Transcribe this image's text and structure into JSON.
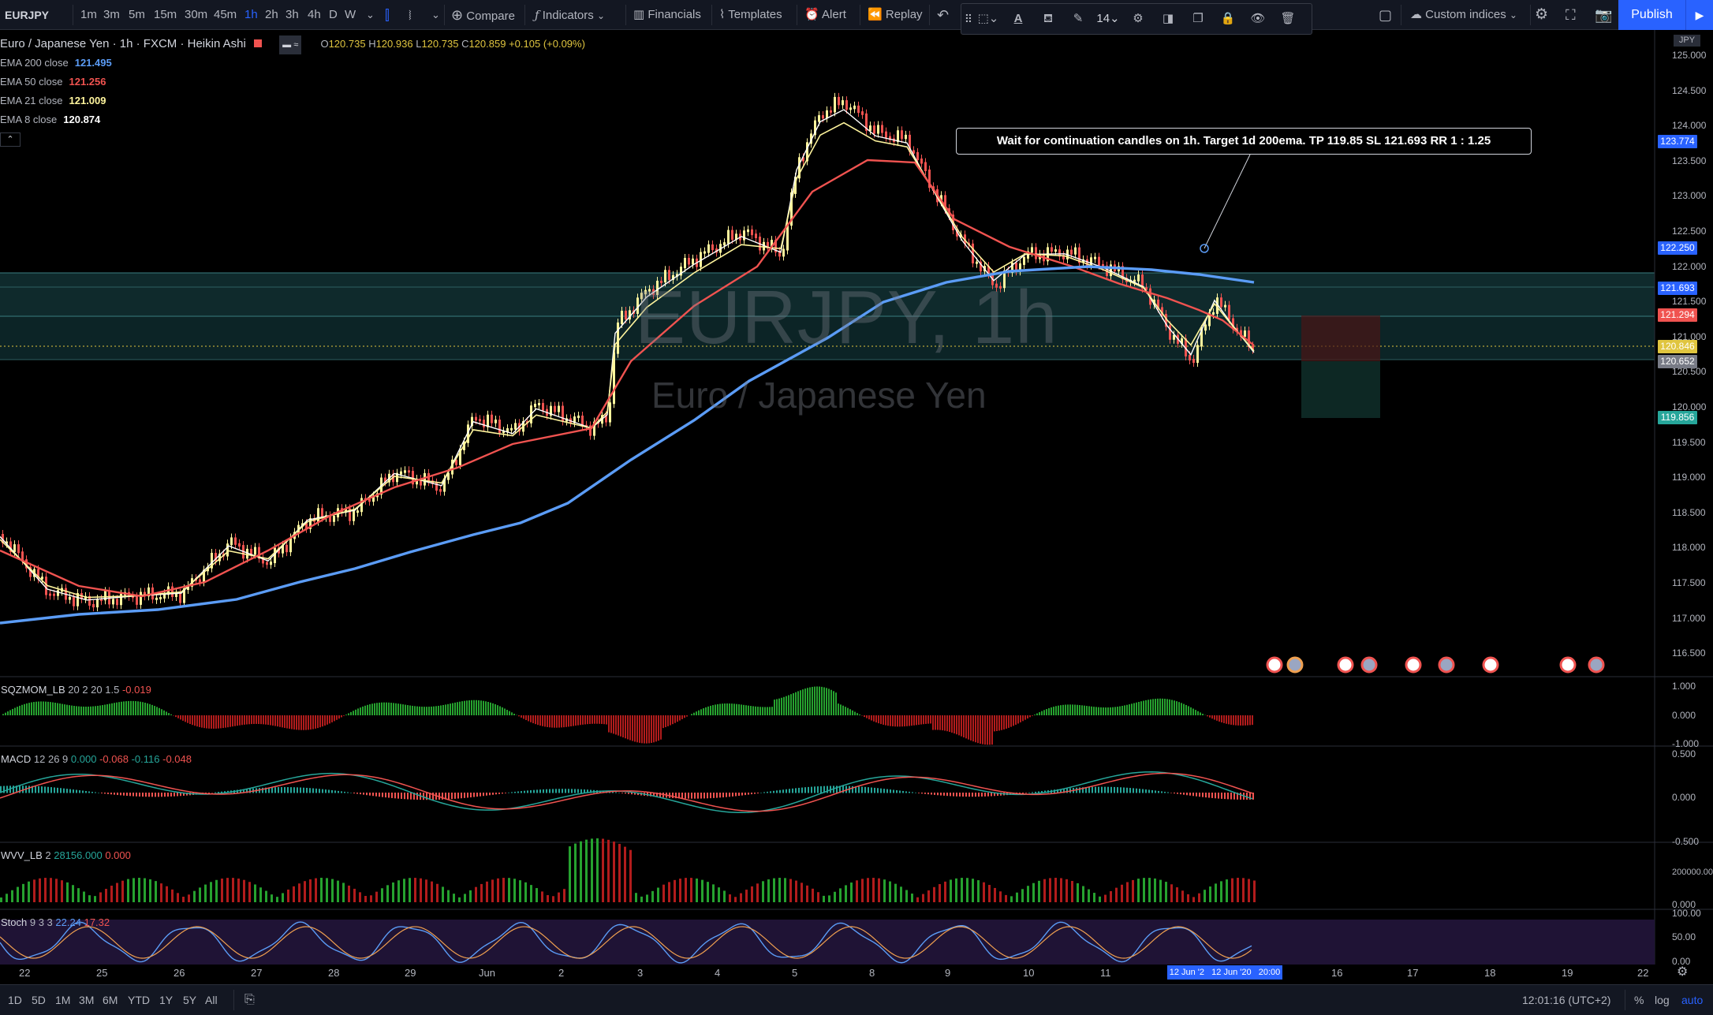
{
  "symbol": "EURJPY",
  "toolbar": {
    "intervals": [
      "1m",
      "3m",
      "5m",
      "15m",
      "30m",
      "45m",
      "1h",
      "2h",
      "3h",
      "4h",
      "D",
      "W"
    ],
    "active_interval": "1h",
    "compare": "Compare",
    "indicators": "Indicators",
    "financials": "Financials",
    "templates": "Templates",
    "alert": "Alert",
    "replay": "Replay",
    "custom_indices": "Custom indices",
    "publish": "Publish",
    "font_size": "14"
  },
  "legend": {
    "title": "Euro / Japanese Yen · 1h · FXCM · Heikin Ashi",
    "o_label": "O",
    "o": "120.735",
    "h_label": "H",
    "h": "120.936",
    "l_label": "L",
    "l": "120.735",
    "c_label": "C",
    "c": "120.859",
    "change": "+0.105 (+0.09%)",
    "emas": [
      {
        "name": "EMA 200 close",
        "value": "121.495",
        "color": "#5b9cf6"
      },
      {
        "name": "EMA 50 close",
        "value": "121.256",
        "color": "#f05350"
      },
      {
        "name": "EMA 21 close",
        "value": "121.009",
        "color": "#fff59d"
      },
      {
        "name": "EMA 8 close",
        "value": "120.874",
        "color": "#ffffff"
      }
    ]
  },
  "watermark": {
    "line1": "EURJPY, 1h",
    "line2": "Euro / Japanese Yen"
  },
  "annotation": "Wait for continuation candles on 1h. Target 1d 200ema. TP 119.85 SL 121.693 RR 1 : 1.25",
  "price_axis": {
    "currency": "JPY",
    "labels": [
      "125.000",
      "124.500",
      "124.000",
      "123.500",
      "123.000",
      "122.500",
      "122.000",
      "121.500",
      "121.000",
      "120.500",
      "120.000",
      "119.500",
      "119.000",
      "118.500",
      "118.000",
      "117.500",
      "117.000",
      "116.500"
    ],
    "tags": [
      {
        "text": "123.774",
        "color": "#2962ff"
      },
      {
        "text": "122.250",
        "color": "#2962ff"
      },
      {
        "text": "121.693",
        "color": "#2962ff"
      },
      {
        "text": "121.294",
        "color": "#f05350"
      },
      {
        "text": "120.846",
        "color": "#e0c53f"
      },
      {
        "text": "120.652",
        "color": "#787b86"
      },
      {
        "text": "119.856",
        "color": "#26a69a"
      }
    ]
  },
  "indicators": {
    "sqz": {
      "name": "SQZMOM_LB",
      "params": "20 2 20 1.5",
      "value": "-0.019",
      "axis": [
        "1.000",
        "0.000",
        "-1.000"
      ]
    },
    "macd": {
      "name": "MACD",
      "params": "12 26 9",
      "v1": "0.000",
      "v2": "-0.068",
      "v3": "-0.116",
      "v4": "-0.048",
      "axis": [
        "0.500",
        "0.000",
        "-0.500"
      ]
    },
    "wvf": {
      "name": "WVV_LB",
      "params": "2",
      "v1": "28156.000",
      "v2": "0.000",
      "axis": [
        "200000.000",
        "0.000"
      ]
    },
    "stoch": {
      "name": "Stoch",
      "params": "9 3 3",
      "k": "22.24",
      "d": "17.32",
      "axis": [
        "100.00",
        "50.00",
        "0.00"
      ]
    }
  },
  "time_axis": {
    "labels": [
      "22",
      "25",
      "26",
      "27",
      "28",
      "29",
      "Jun",
      "2",
      "3",
      "4",
      "5",
      "8",
      "9",
      "10",
      "11",
      "16",
      "17",
      "18",
      "19",
      "22"
    ],
    "highlight": "12 Jun '2   12 Jun '20   20:00"
  },
  "bottombar": {
    "ranges": [
      "1D",
      "5D",
      "1M",
      "3M",
      "6M",
      "YTD",
      "1Y",
      "5Y",
      "All"
    ],
    "clock": "12:01:16 (UTC+2)",
    "percent": "%",
    "log": "log",
    "auto": "auto"
  }
}
